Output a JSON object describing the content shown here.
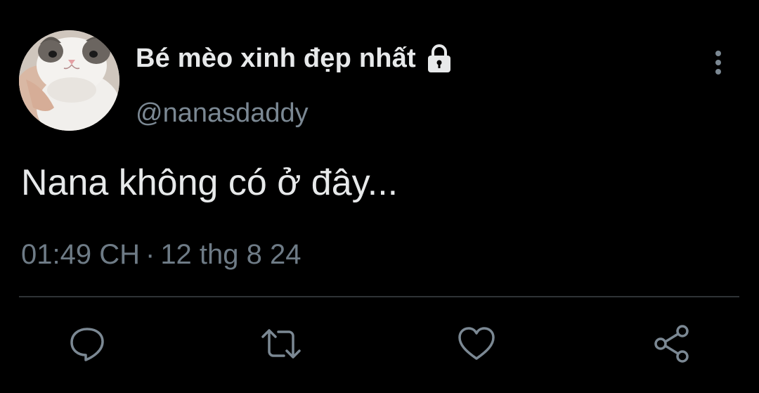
{
  "tweet": {
    "display_name": "Bé mèo xinh đẹp nhất",
    "handle": "@nanasdaddy",
    "text": "Nana không có ở đây...",
    "time": "01:49 CH",
    "date": "12 thg 8 24",
    "separator": "·"
  },
  "icons": {
    "lock": "lock-icon",
    "more": "more-vertical-icon",
    "reply": "reply-icon",
    "retweet": "retweet-icon",
    "like": "heart-icon",
    "share": "share-icon"
  },
  "colors": {
    "background": "#000000",
    "primary_text": "#e7e9ea",
    "secondary_text": "#7b8893",
    "icon": "#7b8893",
    "divider": "#2f3336"
  }
}
